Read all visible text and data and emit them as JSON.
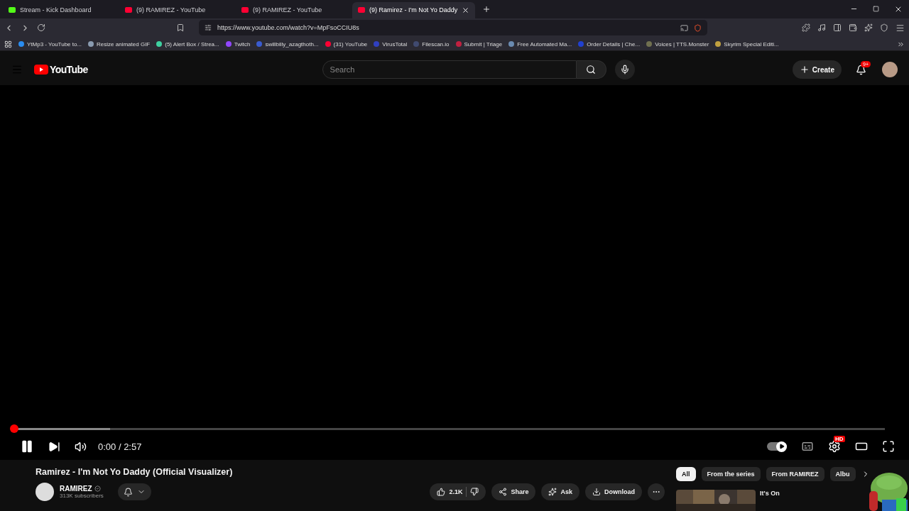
{
  "browser": {
    "tabs": [
      {
        "title": "Stream - Kick Dashboard",
        "color": "#53fc18",
        "selected": false
      },
      {
        "title": "(9) RAMIREZ - YouTube",
        "color": "#ff0033",
        "selected": false
      },
      {
        "title": "(9) RAMIREZ - YouTube",
        "color": "#ff0033",
        "selected": false
      },
      {
        "title": "(9) Ramirez - I'm Not Yo Daddy",
        "color": "#ff0033",
        "selected": true
      }
    ],
    "url": "https://www.youtube.com/watch?v=MpFsoCCIU8s",
    "bookmarks": [
      {
        "title": "YtMp3 - YouTube to...",
        "color": "#2a8cf0"
      },
      {
        "title": "Resize animated GIF",
        "color": "#8a9bb0"
      },
      {
        "title": "(5) Alert Box / Strea...",
        "color": "#3fd0a0"
      },
      {
        "title": "Twitch",
        "color": "#9146ff"
      },
      {
        "title": "swillbilly_azagthoth...",
        "color": "#3a5bd0"
      },
      {
        "title": "(31) YouTube",
        "color": "#ff0033"
      },
      {
        "title": "VirusTotal",
        "color": "#3040c0"
      },
      {
        "title": "Filescan.io",
        "color": "#404a70"
      },
      {
        "title": "Submit | Triage",
        "color": "#c02040"
      },
      {
        "title": "Free Automated Ma...",
        "color": "#6a8ab0"
      },
      {
        "title": "Order Details | Che...",
        "color": "#2040d0"
      },
      {
        "title": "Voices | TTS.Monster",
        "color": "#707050"
      },
      {
        "title": "Skyrim Special Editi...",
        "color": "#c0a040"
      }
    ]
  },
  "youtube": {
    "logo": "YouTube",
    "search": {
      "placeholder": "Search"
    },
    "create": "Create",
    "notifications": "9+",
    "player": {
      "progress": {
        "level": 0
      },
      "buffer": {
        "level": 0.11
      },
      "playing": true,
      "time": "0:00 / 2:57",
      "quality": "HD",
      "autoplay": {
        "on": true
      }
    },
    "video": {
      "title": "Ramirez - I'm Not Yo Daddy (Official Visualizer)",
      "channel": "RAMIREZ",
      "subscribers": "313K subscribers",
      "actions": [
        {
          "kind": "like",
          "label": "2.1K"
        },
        {
          "kind": "share",
          "label": "Share"
        },
        {
          "kind": "ask",
          "label": "Ask"
        },
        {
          "kind": "download",
          "label": "Download"
        },
        {
          "kind": "more"
        }
      ]
    },
    "chips": [
      {
        "label": "All",
        "selected": true
      },
      {
        "label": "From the series",
        "selected": false
      },
      {
        "label": "From RAMIREZ",
        "selected": false
      },
      {
        "label": "Albu",
        "selected": false
      }
    ],
    "recommendation": {
      "title": "It's On"
    }
  }
}
